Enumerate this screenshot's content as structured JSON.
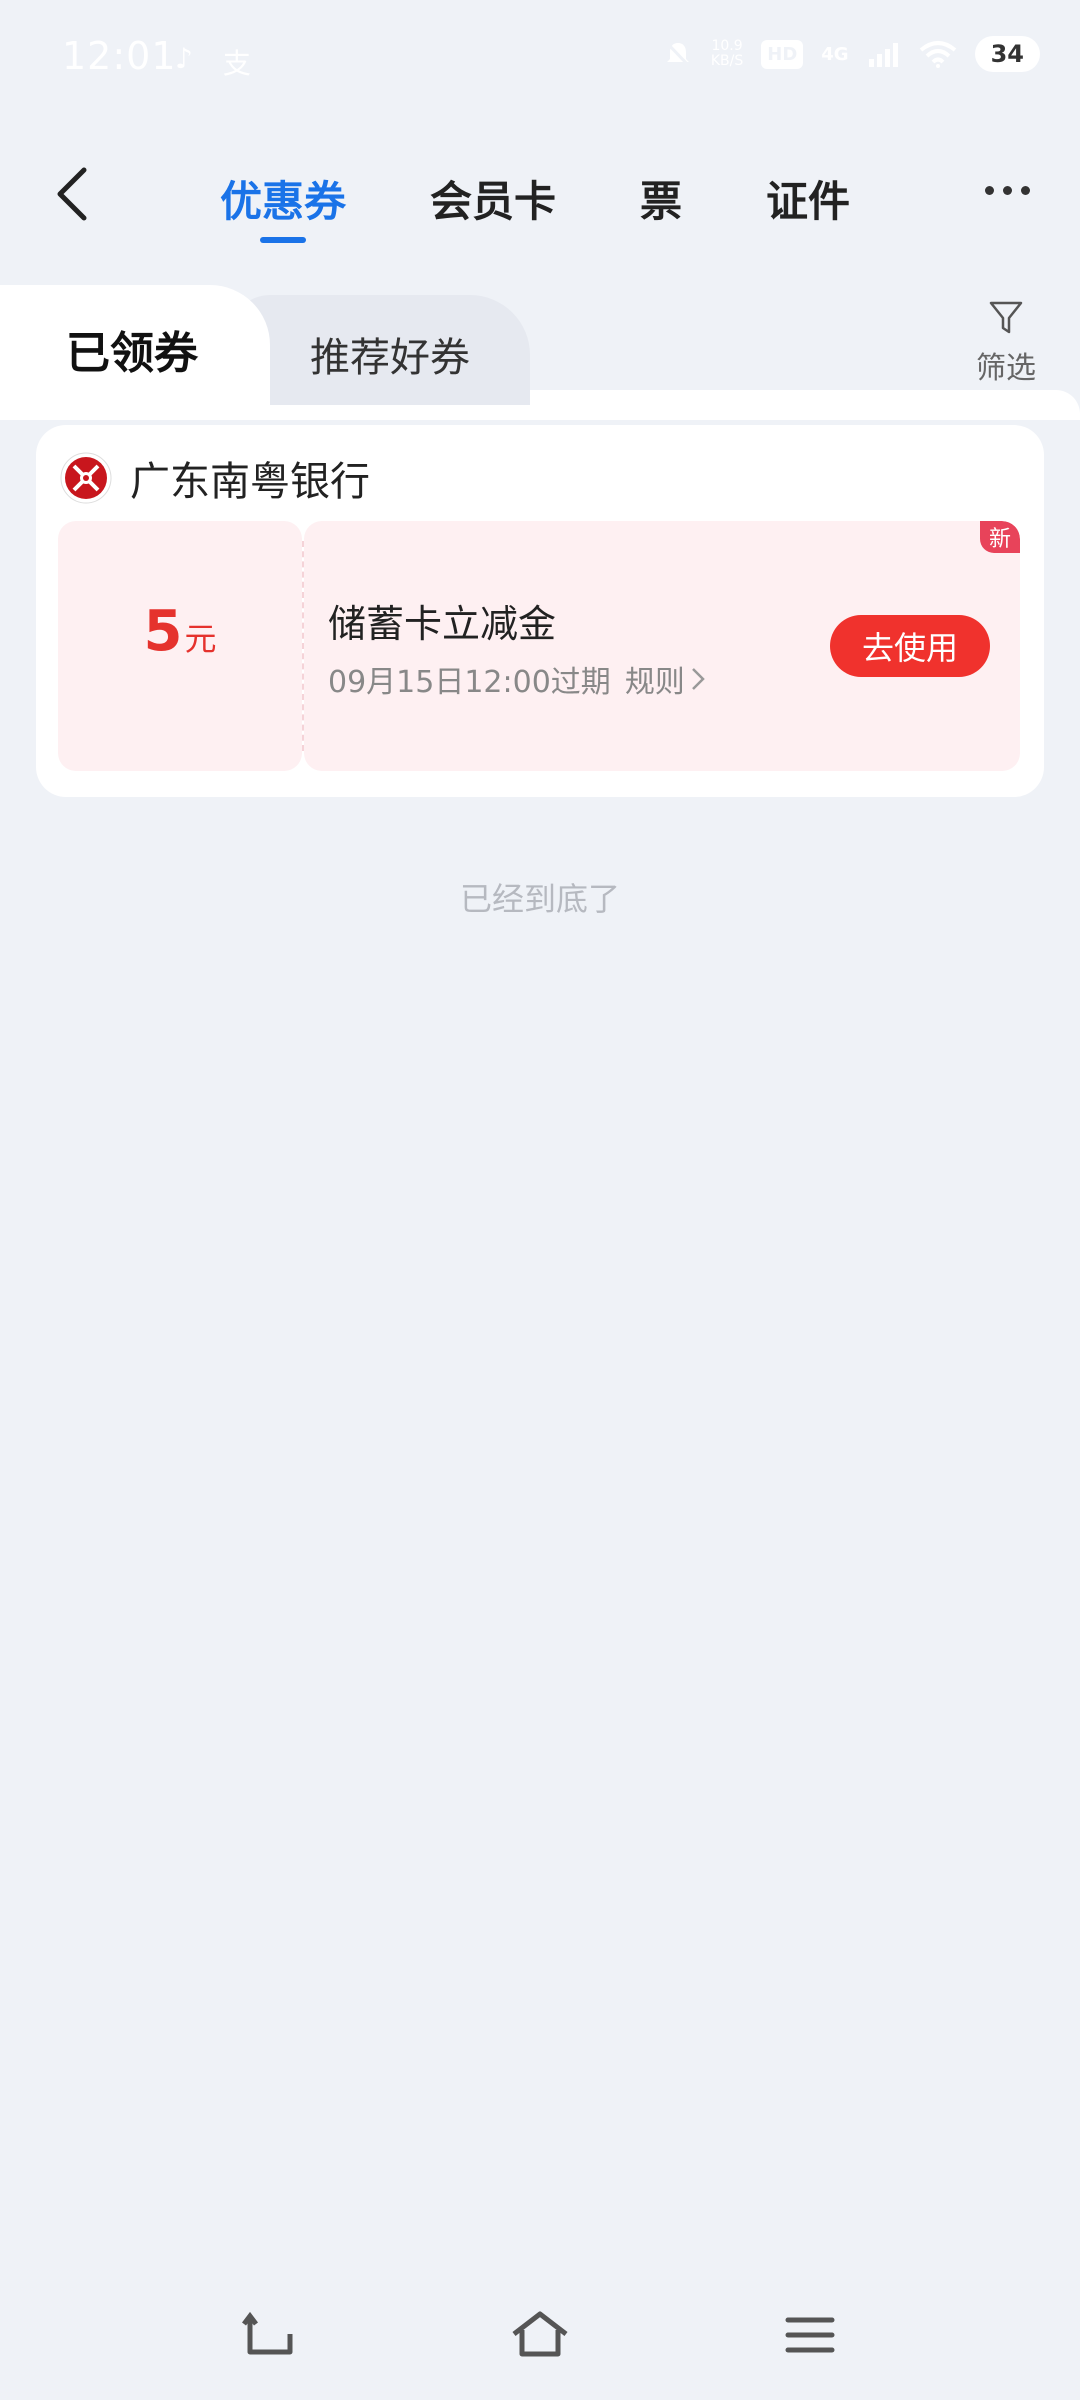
{
  "status_bar": {
    "time": "12:01",
    "net_speed_value": "10.9",
    "net_speed_unit": "KB/S",
    "hd_badge": "HD",
    "network_type": "4G",
    "battery": "34"
  },
  "header": {
    "tabs": [
      {
        "label": "优惠券",
        "active": true
      },
      {
        "label": "会员卡",
        "active": false
      },
      {
        "label": "票",
        "active": false
      },
      {
        "label": "证件",
        "active": false
      }
    ]
  },
  "sub_tabs": {
    "active": "已领券",
    "inactive": "推荐好券",
    "filter_label": "筛选"
  },
  "card": {
    "bank_name": "广东南粤银行",
    "coupon": {
      "amount": "5",
      "unit": "元",
      "title": "储蓄卡立减金",
      "expiry": "09月15日12:00过期",
      "rules": "规则",
      "use_button": "去使用",
      "new_badge": "新"
    }
  },
  "end_text": "已经到底了",
  "colors": {
    "accent": "#1a73e8",
    "coupon_red": "#e5322d",
    "button_red": "#f0322d",
    "coupon_bg": "#fef0f2",
    "page_bg": "#eff2f7"
  }
}
